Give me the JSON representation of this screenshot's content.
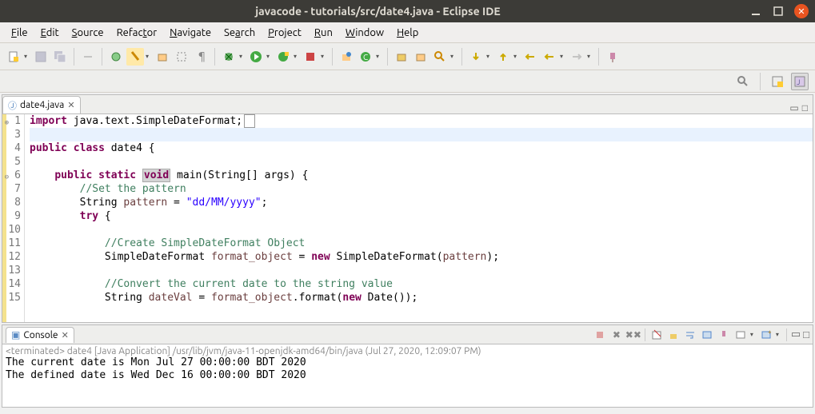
{
  "window": {
    "title": "javacode - tutorials/src/date4.java - Eclipse IDE"
  },
  "menu": [
    "File",
    "Edit",
    "Source",
    "Refactor",
    "Navigate",
    "Search",
    "Project",
    "Run",
    "Window",
    "Help"
  ],
  "tab": {
    "label": "date4.java",
    "dirty": "✕"
  },
  "code": {
    "lines": [
      {
        "n": "1",
        "fold": "⊕"
      },
      {
        "n": "3"
      },
      {
        "n": "4"
      },
      {
        "n": "5"
      },
      {
        "n": "6",
        "fold": "⊖"
      },
      {
        "n": "7"
      },
      {
        "n": "8"
      },
      {
        "n": "9"
      },
      {
        "n": "10"
      },
      {
        "n": "11"
      },
      {
        "n": "12"
      },
      {
        "n": "13"
      },
      {
        "n": "14"
      },
      {
        "n": "15"
      }
    ],
    "l1_import": "import",
    "l1_rest": " java.text.SimpleDateFormat;",
    "l4_public": "public",
    "l4_class": "class",
    "l4_name": " date4 {",
    "l6_public": "public",
    "l6_static": "static",
    "l6_void": "void",
    "l6_rest": " main(String[] args) {",
    "l7_cmt": "//Set the pattern",
    "l8_pre": "        String ",
    "l8_var": "pattern",
    "l8_mid": " = ",
    "l8_str": "\"dd/MM/yyyy\"",
    "l8_end": ";",
    "l9_try": "try",
    "l9_rest": " {",
    "l11_cmt": "//Create SimpleDateFormat Object",
    "l12_pre": "            SimpleDateFormat ",
    "l12_var": "format_object",
    "l12_mid": " = ",
    "l12_new": "new",
    "l12_rest": " SimpleDateFormat(",
    "l12_arg": "pattern",
    "l12_end": ");",
    "l14_cmt": "//Convert the current date to the string value",
    "l15_pre": "            String ",
    "l15_var": "dateVal",
    "l15_mid": " = ",
    "l15_call": "format_object",
    "l15_rest": ".format(",
    "l15_new": "new",
    "l15_end": " Date());"
  },
  "console": {
    "title": "Console",
    "header": "<terminated> date4 [Java Application] /usr/lib/jvm/java-11-openjdk-amd64/bin/java (Jul 27, 2020, 12:09:07 PM)",
    "line1": "The current date is Mon Jul 27 00:00:00 BDT 2020",
    "line2": "The defined date is Wed Dec 16 00:00:00 BDT 2020"
  }
}
